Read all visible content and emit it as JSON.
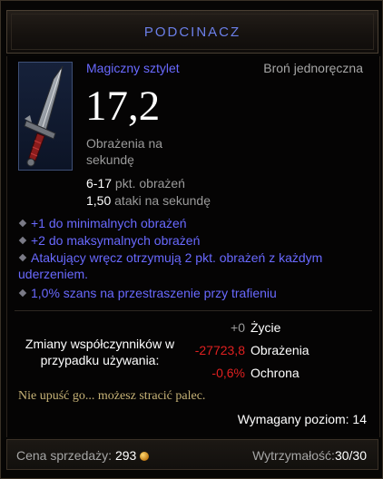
{
  "item": {
    "name": "PODCINACZ",
    "type": "Magiczny sztylet",
    "slot": "Broń jednoręczna",
    "dps": "17,2",
    "dps_label": "Obrażenia na sekundę",
    "damage_value": "6-17",
    "damage_label": "pkt. obrażeń",
    "speed_value": "1,50",
    "speed_label": "ataki na sekundę",
    "icon": "dagger-icon"
  },
  "affixes": [
    "+1 do minimalnych obrażeń",
    "+2 do maksymalnych obrażeń",
    "Atakujący wręcz otrzymują 2 pkt. obrażeń z każdym uderzeniem.",
    "1,0% szans na przestraszenie przy trafieniu"
  ],
  "stat_changes": {
    "label": "Zmiany współczynników w przypadku używania:",
    "rows": [
      {
        "value": "+0",
        "name": "Życie",
        "color": "#9a9a9a"
      },
      {
        "value": "-27723,8",
        "name": "Obrażenia",
        "color": "#e02020"
      },
      {
        "value": "-0,6%",
        "name": "Ochrona",
        "color": "#e02020"
      }
    ]
  },
  "flavor_text": "Nie upuść go... możesz stracić palec.",
  "required_level": "Wymagany poziom: 14",
  "footer": {
    "sell_label": "Cena sprzedaży:",
    "sell_value": "293",
    "coin_icon": "gold-coin-icon",
    "durability_label": "Wytrzymałość:",
    "durability_value": "30/30"
  },
  "colors": {
    "title": "#6b7fe8",
    "magic": "#6969ff",
    "negative": "#e02020",
    "flavor": "#c7b377"
  }
}
